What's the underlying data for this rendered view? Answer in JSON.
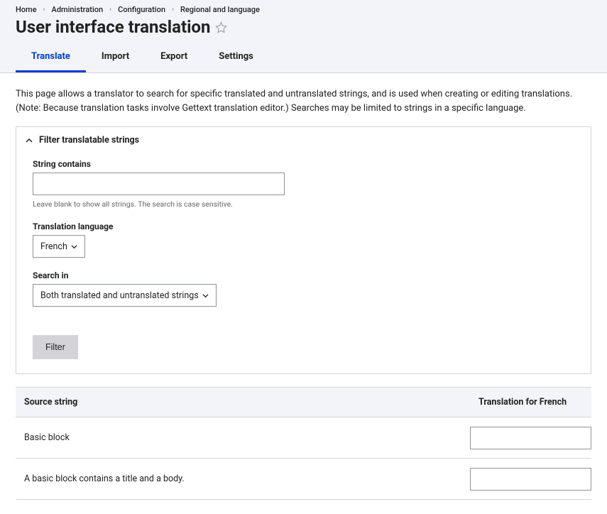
{
  "breadcrumb": {
    "items": [
      {
        "label": "Home"
      },
      {
        "label": "Administration"
      },
      {
        "label": "Configuration"
      },
      {
        "label": "Regional and language"
      }
    ]
  },
  "page_title": "User interface translation",
  "tabs": {
    "items": [
      {
        "label": "Translate",
        "active": true
      },
      {
        "label": "Import",
        "active": false
      },
      {
        "label": "Export",
        "active": false
      },
      {
        "label": "Settings",
        "active": false
      }
    ]
  },
  "description": "This page allows a translator to search for specific translated and untranslated strings, and is used when creating or editing translations. (Note: Because translation tasks involve Gettext translation editor.) Searches may be limited to strings in a specific language.",
  "filter": {
    "legend": "Filter translatable strings",
    "string_contains": {
      "label": "String contains",
      "value": "",
      "help": "Leave blank to show all strings. The search is case sensitive."
    },
    "translation_language": {
      "label": "Translation language",
      "selected": "French"
    },
    "search_in": {
      "label": "Search in",
      "selected": "Both translated and untranslated strings"
    },
    "button_label": "Filter"
  },
  "table": {
    "headers": {
      "source": "Source string",
      "translation": "Translation for French"
    },
    "rows": [
      {
        "source": "Basic block",
        "translation": ""
      },
      {
        "source": "A basic block contains a title and a body.",
        "translation": ""
      }
    ]
  }
}
